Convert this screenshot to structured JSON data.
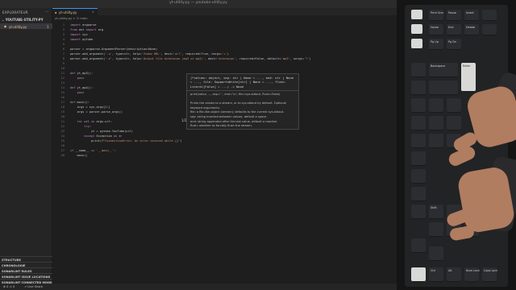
{
  "window": {
    "title": "yt-utility.py — youtube-utility.py"
  },
  "sidebar": {
    "header": "EXPLORATEUR",
    "folder": "YOUTUBE-UTILITY-PY",
    "file": {
      "name": "yt-utility.py",
      "badge": "1"
    },
    "sections": [
      "STRUCTURE",
      "CHRONOLOGIE",
      "SONARLINT RULES",
      "SONARLINT ISSUE LOCATIONS",
      "SONARLINT CONNECTED MODE"
    ]
  },
  "tab": {
    "label": "yt-utility.py"
  },
  "breadcrumb": "yt-utility.py > ⊙ main",
  "code": [
    {
      "n": "1",
      "t": "import argparse"
    },
    {
      "n": "2",
      "t": "from ast import arg"
    },
    {
      "n": "3",
      "t": "import sys"
    },
    {
      "n": "4",
      "t": "import pytube"
    },
    {
      "n": "5",
      "t": ""
    },
    {
      "n": "6",
      "t": "parser = argparse.ArgumentParser(description=None)"
    },
    {
      "n": "7",
      "t": "parser.add_argument('-u', type=str, help='Video URL', dest='url', required=True, nargs='+')"
    },
    {
      "n": "8",
      "t": "parser.add_argument('-e', type=str, help='Output file extension (mp3 or mp4)', dest='extension', required=False, default='mp3', nargs='?')"
    },
    {
      "n": "9",
      "t": ""
    },
    {
      "n": "10",
      "t": ""
    },
    {
      "n": "11",
      "t": "def yt_mp3():"
    },
    {
      "n": "12",
      "t": "    pass"
    },
    {
      "n": "13",
      "t": ""
    },
    {
      "n": "14",
      "t": "def yt_mp4():"
    },
    {
      "n": "15",
      "t": "    pass"
    },
    {
      "n": "16",
      "t": ""
    },
    {
      "n": "17",
      "t": "def main():"
    },
    {
      "n": "18",
      "t": "    args = sys.argv[1:]"
    },
    {
      "n": "19",
      "t": "    args = parser.parse_args()"
    },
    {
      "n": "20",
      "t": ""
    },
    {
      "n": "21",
      "t": "    for url in args.url:"
    },
    {
      "n": "22",
      "t": "        try:"
    },
    {
      "n": "23",
      "t": "            yt = pytube.YouTube(url)"
    },
    {
      "n": "24",
      "t": "        except Exception as e:"
    },
    {
      "n": "25",
      "t": "            print(f\"ConnectionError: An error occured while {}\")"
    },
    {
      "n": "26",
      "t": ""
    },
    {
      "n": "27",
      "t": "if __name__ == '__main__':"
    },
    {
      "n": "28",
      "t": "    main()"
    }
  ],
  "popup": {
    "signature": "(*values: object, sep: str | None = ..., end: str | None = ..., file: SupportsWrite[str] | None = ..., flush: Literal[False] = ...) -> None",
    "lines": [
      "print(value, ..., sep=' ', end='\\n', file=sys.stdout, flush=False)",
      "",
      "Prints the values to a stream, or to sys.stdout by default. Optional",
      "keyword arguments:",
      "file: a file-like object (stream); defaults to the current sys.stdout.",
      "sep: string inserted between values, default a space.",
      "end: string appended after the last value, default a newline.",
      "flush: whether to forcibly flush the stream."
    ],
    "counter": "1/2"
  },
  "statusbar": {
    "errors": "⊗ 0  ⚠ 0",
    "live_share": "Live Share"
  },
  "keyboard": {
    "labels": [
      "Print Scrn",
      "Pause",
      "Home",
      "End",
      "Pg Up",
      "Pg Dn",
      "Insert",
      "Delete",
      "Backspace",
      "Enter",
      "Shift",
      "Ctrl",
      "Num Lock",
      "Caps Lock",
      "Alt"
    ]
  },
  "colors": {
    "accent": "#3794ff",
    "keyword": "#c586c0",
    "string": "#ce9178",
    "function": "#dcdcaa"
  }
}
